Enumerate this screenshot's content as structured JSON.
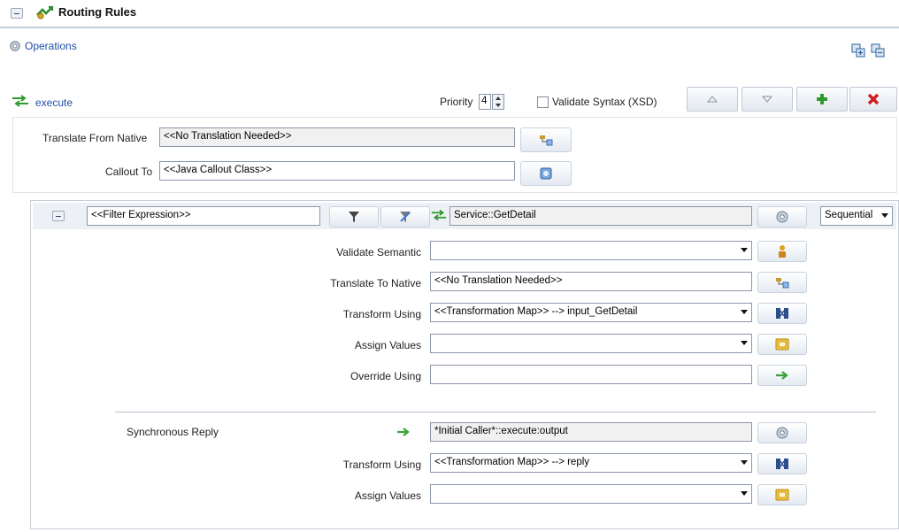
{
  "header": {
    "title": "Routing Rules",
    "operations_link": "Operations"
  },
  "rule": {
    "operation_name": "execute",
    "priority_label": "Priority",
    "priority_value": "4",
    "validate_syntax_label": "Validate Syntax (XSD)",
    "validate_syntax_checked": false
  },
  "source": {
    "translate_from_native_label": "Translate From Native",
    "translate_from_native_value": "<<No Translation Needed>>",
    "callout_to_label": "Callout To",
    "callout_to_value": "<<Java Callout Class>>"
  },
  "target": {
    "filter_expression": "<<Filter Expression>>",
    "service_name": "Service::GetDetail",
    "execution_mode": "Sequential",
    "validate_semantic_label": "Validate Semantic",
    "validate_semantic_value": "",
    "translate_to_native_label": "Translate To Native",
    "translate_to_native_value": "<<No Translation Needed>>",
    "transform_using_label": "Transform Using",
    "transform_using_value": "<<Transformation Map>> --> input_GetDetail",
    "assign_values_label": "Assign Values",
    "assign_values_value": "",
    "override_using_label": "Override Using",
    "override_using_value": ""
  },
  "reply": {
    "synchronous_reply_label": "Synchronous Reply",
    "reply_target": "*Initial Caller*::execute:output",
    "transform_using_label": "Transform Using",
    "transform_using_value": "<<Transformation Map>> --> reply",
    "assign_values_label": "Assign Values",
    "assign_values_value": ""
  },
  "icons": {
    "operations": "gear-icon",
    "execute": "routing-arrows-icon",
    "add": "plus-icon",
    "delete": "x-icon"
  },
  "colors": {
    "link": "#1f4fa8",
    "add_green": "#2e9a2e",
    "delete_red": "#cc1f1f",
    "arrow_green": "#3aa33a"
  }
}
